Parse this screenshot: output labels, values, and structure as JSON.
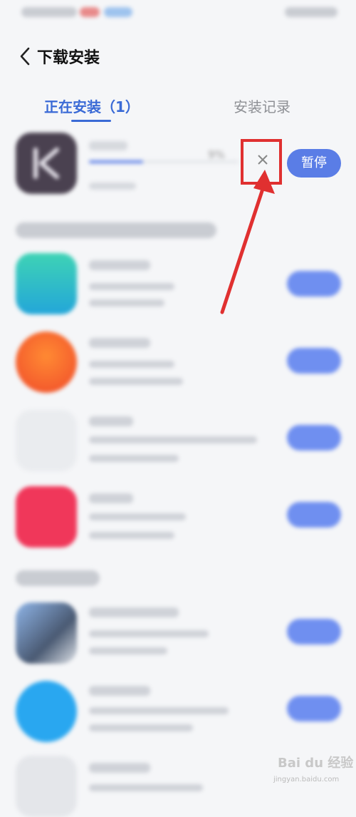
{
  "header": {
    "title": "下载安装"
  },
  "tabs": [
    {
      "label": "正在安装（1）",
      "active": true
    },
    {
      "label": "安装记录",
      "active": false
    }
  ],
  "installing": {
    "progress_percent": 9,
    "progress_text": "9%",
    "pause_label": "暂停"
  },
  "colors": {
    "accent": "#5a7de6",
    "tab_active": "#3a6ad6",
    "highlight": "#e03030"
  },
  "icons": [
    "back-icon",
    "close-icon",
    "app-icon"
  ],
  "watermark": {
    "logo": "Bai du 经验",
    "url": "jingyan.baidu.com"
  }
}
